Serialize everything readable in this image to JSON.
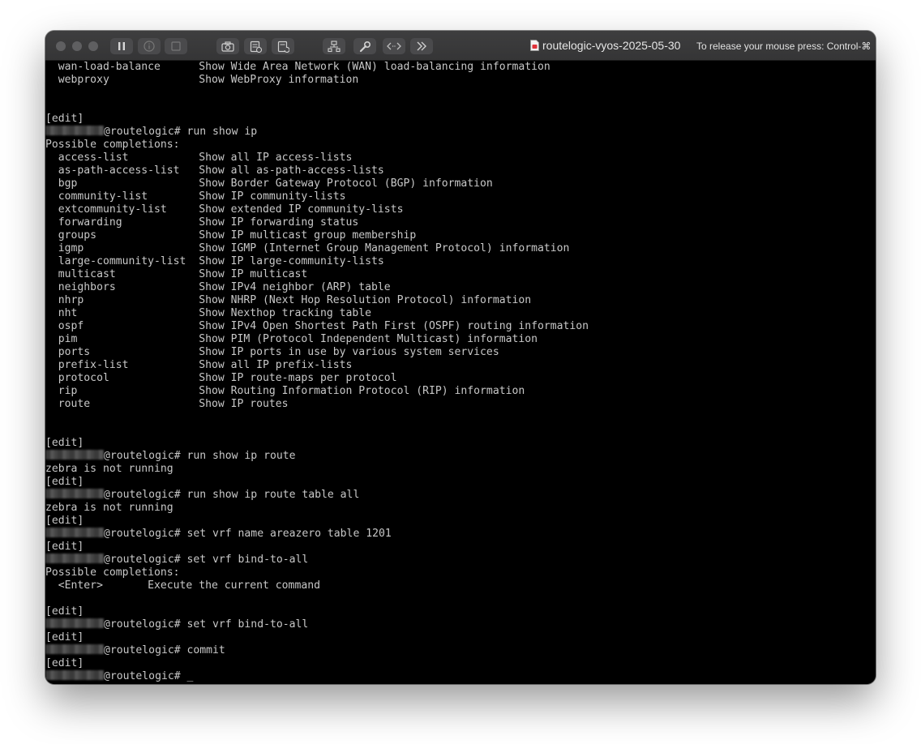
{
  "window": {
    "title": "routelogic-vyos-2025-05-30",
    "release_hint": "To release your mouse press: Control-⌘"
  },
  "toolbar": {
    "buttons": [
      {
        "name": "pause-icon"
      },
      {
        "name": "info-icon"
      },
      {
        "name": "stop-icon"
      },
      {
        "name": "camera-icon"
      },
      {
        "name": "snapshot-icon"
      },
      {
        "name": "restore-snapshot-icon"
      },
      {
        "name": "network-icon"
      },
      {
        "name": "wrench-icon"
      },
      {
        "name": "code-icon"
      },
      {
        "name": "chevron-right-double-icon"
      }
    ]
  },
  "terminal": {
    "prompt_host": "@routelogic#",
    "lines": [
      {
        "type": "text",
        "text": "  wan-load-balance      Show Wide Area Network (WAN) load-balancing information"
      },
      {
        "type": "text",
        "text": "  webproxy              Show WebProxy information"
      },
      {
        "type": "text",
        "text": ""
      },
      {
        "type": "text",
        "text": ""
      },
      {
        "type": "text",
        "text": "[edit]"
      },
      {
        "type": "prompt",
        "text": "@routelogic# run show ip"
      },
      {
        "type": "text",
        "text": "Possible completions:"
      },
      {
        "type": "text",
        "text": "  access-list           Show all IP access-lists"
      },
      {
        "type": "text",
        "text": "  as-path-access-list   Show all as-path-access-lists"
      },
      {
        "type": "text",
        "text": "  bgp                   Show Border Gateway Protocol (BGP) information"
      },
      {
        "type": "text",
        "text": "  community-list        Show IP community-lists"
      },
      {
        "type": "text",
        "text": "  extcommunity-list     Show extended IP community-lists"
      },
      {
        "type": "text",
        "text": "  forwarding            Show IP forwarding status"
      },
      {
        "type": "text",
        "text": "  groups                Show IP multicast group membership"
      },
      {
        "type": "text",
        "text": "  igmp                  Show IGMP (Internet Group Management Protocol) information"
      },
      {
        "type": "text",
        "text": "  large-community-list  Show IP large-community-lists"
      },
      {
        "type": "text",
        "text": "  multicast             Show IP multicast"
      },
      {
        "type": "text",
        "text": "  neighbors             Show IPv4 neighbor (ARP) table"
      },
      {
        "type": "text",
        "text": "  nhrp                  Show NHRP (Next Hop Resolution Protocol) information"
      },
      {
        "type": "text",
        "text": "  nht                   Show Nexthop tracking table"
      },
      {
        "type": "text",
        "text": "  ospf                  Show IPv4 Open Shortest Path First (OSPF) routing information"
      },
      {
        "type": "text",
        "text": "  pim                   Show PIM (Protocol Independent Multicast) information"
      },
      {
        "type": "text",
        "text": "  ports                 Show IP ports in use by various system services"
      },
      {
        "type": "text",
        "text": "  prefix-list           Show all IP prefix-lists"
      },
      {
        "type": "text",
        "text": "  protocol              Show IP route-maps per protocol"
      },
      {
        "type": "text",
        "text": "  rip                   Show Routing Information Protocol (RIP) information"
      },
      {
        "type": "text",
        "text": "  route                 Show IP routes"
      },
      {
        "type": "text",
        "text": ""
      },
      {
        "type": "text",
        "text": ""
      },
      {
        "type": "text",
        "text": "[edit]"
      },
      {
        "type": "prompt",
        "text": "@routelogic# run show ip route"
      },
      {
        "type": "text",
        "text": "zebra is not running"
      },
      {
        "type": "text",
        "text": "[edit]"
      },
      {
        "type": "prompt",
        "text": "@routelogic# run show ip route table all"
      },
      {
        "type": "text",
        "text": "zebra is not running"
      },
      {
        "type": "text",
        "text": "[edit]"
      },
      {
        "type": "prompt",
        "text": "@routelogic# set vrf name areazero table 1201"
      },
      {
        "type": "text",
        "text": "[edit]"
      },
      {
        "type": "prompt",
        "text": "@routelogic# set vrf bind-to-all"
      },
      {
        "type": "text",
        "text": "Possible completions:"
      },
      {
        "type": "text",
        "text": "  <Enter>       Execute the current command"
      },
      {
        "type": "text",
        "text": ""
      },
      {
        "type": "text",
        "text": "[edit]"
      },
      {
        "type": "prompt",
        "text": "@routelogic# set vrf bind-to-all"
      },
      {
        "type": "text",
        "text": "[edit]"
      },
      {
        "type": "prompt",
        "text": "@routelogic# commit"
      },
      {
        "type": "text",
        "text": "[edit]"
      },
      {
        "type": "prompt",
        "text": "@routelogic# ",
        "cursor": "_"
      }
    ]
  },
  "colors": {
    "terminal_bg": "#000000",
    "terminal_fg": "#c8c8c8",
    "titlebar_bg": "#3a3a3b"
  }
}
